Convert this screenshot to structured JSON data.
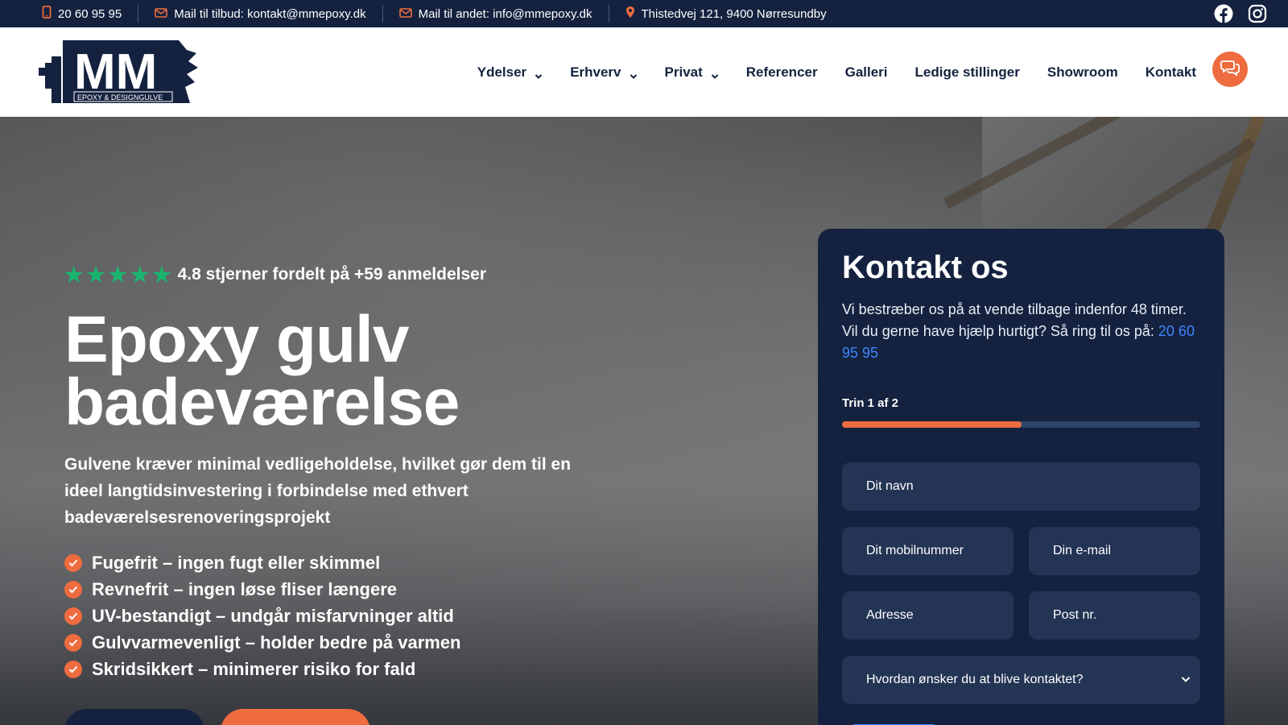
{
  "topbar": {
    "phone": "20 60 95 95",
    "mail_offer": "Mail til tilbud: kontakt@mmepoxy.dk",
    "mail_other": "Mail til andet: info@mmepoxy.dk",
    "address": "Thistedvej 121, 9400 Nørresundby"
  },
  "header": {
    "logo_text": "MM",
    "logo_tagline": "EPOXY & DESIGNGULVE",
    "nav": [
      {
        "label": "Ydelser"
      },
      {
        "label": "Erhverv"
      },
      {
        "label": "Privat"
      },
      {
        "label": "Referencer"
      },
      {
        "label": "Galleri"
      },
      {
        "label": "Ledige stillinger"
      },
      {
        "label": "Showroom"
      },
      {
        "label": "Kontakt"
      }
    ]
  },
  "hero": {
    "rating_text": "4.8 stjerner fordelt på +59 anmeldelser",
    "rating_stars": 5,
    "title_line1": "Epoxy gulv",
    "title_line2": "badeværelse",
    "subtitle": "Gulvene kræver minimal vedligeholdelse, hvilket gør dem til en ideel langtidsinvestering i forbindelse med ethvert badeværelsesrenoveringsprojekt",
    "features": [
      "Fugefrit – ingen fugt eller skimmel",
      "Revnefrit – ingen løse fliser længere",
      "UV-bestandigt – undgår misfarvninger altid",
      "Gulvvarmevenligt – holder bedre på varmen",
      "Skridsikkert – minimerer risiko for fald"
    ]
  },
  "contact": {
    "title": "Kontakt os",
    "description": "Vi bestræber os på at vende tilbage indenfor 48 timer. Vil du gerne have hjælp hurtigt? Så ring til os på: ",
    "phone": "20 60 95 95",
    "step_label": "Trin 1 af 2",
    "progress_percent": 50,
    "fields": {
      "name": "Dit navn",
      "mobile": "Dit mobilnummer",
      "email": "Din e-mail",
      "address": "Adresse",
      "postal": "Post nr.",
      "contact_method": "Hvordan ønsker du at blive kontaktet?"
    }
  },
  "colors": {
    "navy": "#14223f",
    "accent": "#ee6c3f",
    "link_blue": "#3f86ff",
    "star_green": "#19b56f"
  }
}
